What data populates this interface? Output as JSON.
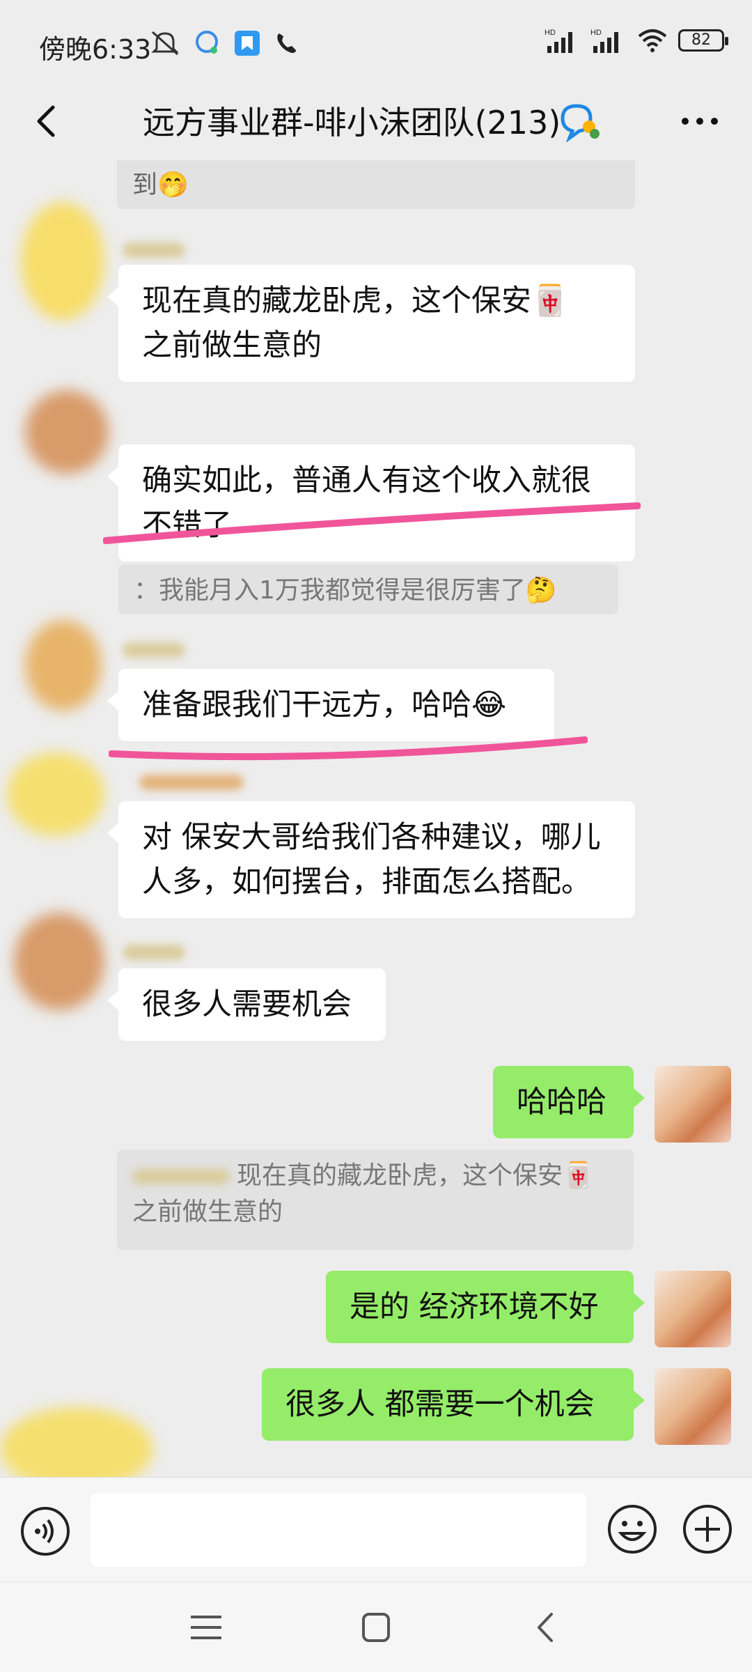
{
  "status_bar": {
    "time": "傍晚6:33",
    "battery": "82",
    "left_icons": [
      "mute-icon",
      "message-app-icon",
      "bookmark-app-icon",
      "phone-icon"
    ],
    "right_icons": [
      "hd-signal-icon",
      "hd-signal-icon",
      "wifi-icon",
      "battery-icon"
    ]
  },
  "header": {
    "title": "远方事业群-啡小沫团队(213)",
    "icons": [
      "back-icon",
      "group-badge-icon",
      "more-icon"
    ]
  },
  "messages": [
    {
      "type": "partial-top",
      "text": "到🤭"
    },
    {
      "type": "incoming",
      "text_lines": [
        "现在真的藏龙卧虎，这个保安🀄",
        "之前做生意的"
      ]
    },
    {
      "type": "incoming",
      "text_lines": [
        "确实如此，普通人有这个收入就很",
        "不错了"
      ],
      "highlighted": true
    },
    {
      "type": "quote",
      "text": "：我能月入1万我都觉得是很厉害了🤔"
    },
    {
      "type": "incoming",
      "text_lines": [
        "准备跟我们干远方，哈哈😂"
      ],
      "highlighted": true
    },
    {
      "type": "incoming",
      "text_lines": [
        "对 保安大哥给我们各种建议，哪儿",
        "人多，如何摆台，排面怎么搭配。"
      ]
    },
    {
      "type": "incoming",
      "text_lines": [
        "很多人需要机会"
      ]
    },
    {
      "type": "outgoing",
      "text_lines": [
        "哈哈哈"
      ]
    },
    {
      "type": "quote",
      "text_lines": [
        "现在真的藏龙卧虎，这个保安🀄",
        "之前做生意的"
      ]
    },
    {
      "type": "outgoing",
      "text_lines": [
        "是的 经济环境不好"
      ]
    },
    {
      "type": "outgoing",
      "text_lines": [
        "很多人 都需要一个机会"
      ]
    }
  ],
  "input_bar": {
    "icons": [
      "voice-icon",
      "emoji-icon",
      "plus-icon"
    ],
    "value": ""
  },
  "nav_bar": {
    "icons": [
      "menu-icon",
      "home-icon",
      "back-nav-icon"
    ]
  },
  "colors": {
    "background": "#ededed",
    "outgoing_bubble": "#95ec69",
    "incoming_bubble": "#ffffff",
    "highlight": "#f0559a"
  }
}
